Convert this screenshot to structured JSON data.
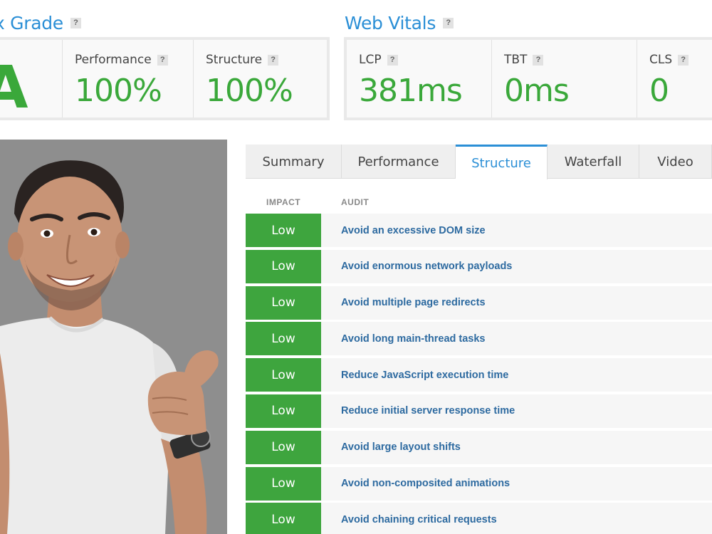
{
  "grade": {
    "title": "x Grade",
    "letter": "A",
    "metrics": [
      {
        "label": "Performance",
        "value": "100%"
      },
      {
        "label": "Structure",
        "value": "100%"
      }
    ]
  },
  "vitals": {
    "title": "Web Vitals",
    "metrics": [
      {
        "label": "LCP",
        "value": "381ms"
      },
      {
        "label": "TBT",
        "value": "0ms"
      },
      {
        "label": "CLS",
        "value": "0"
      }
    ]
  },
  "help_glyph": "?",
  "tabs": [
    "Summary",
    "Performance",
    "Structure",
    "Waterfall",
    "Video"
  ],
  "active_tab": "Structure",
  "table": {
    "impact_header": "IMPACT",
    "audit_header": "AUDIT",
    "rows": [
      {
        "impact": "Low",
        "audit": "Avoid an excessive DOM size"
      },
      {
        "impact": "Low",
        "audit": "Avoid enormous network payloads"
      },
      {
        "impact": "Low",
        "audit": "Avoid multiple page redirects"
      },
      {
        "impact": "Low",
        "audit": "Avoid long main-thread tasks"
      },
      {
        "impact": "Low",
        "audit": "Reduce JavaScript execution time"
      },
      {
        "impact": "Low",
        "audit": "Reduce initial server response time"
      },
      {
        "impact": "Low",
        "audit": "Avoid large layout shifts"
      },
      {
        "impact": "Low",
        "audit": "Avoid non-composited animations"
      },
      {
        "impact": "Low",
        "audit": "Avoid chaining critical requests"
      }
    ]
  },
  "colors": {
    "accent_blue": "#2b8fd6",
    "grade_green": "#3aa83a",
    "impact_green": "#3ea53e",
    "link_blue": "#2d6aa0"
  }
}
